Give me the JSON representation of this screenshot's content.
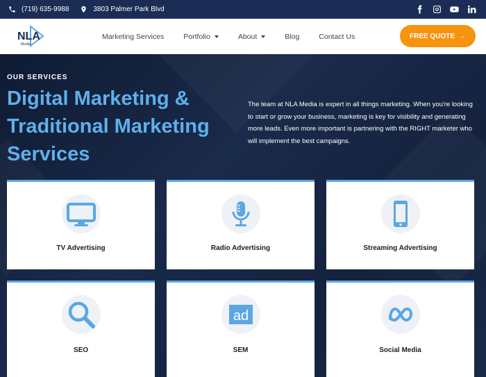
{
  "topbar": {
    "phone": "(719) 635-9988",
    "address": "3803 Palmer Park Blvd",
    "social_icons": [
      "facebook-icon",
      "instagram-icon",
      "youtube-icon",
      "linkedin-icon"
    ]
  },
  "header": {
    "logo_text": "NLA",
    "logo_subtext": "Media",
    "nav": [
      {
        "label": "Marketing Services",
        "dropdown": false
      },
      {
        "label": "Portfolio",
        "dropdown": true
      },
      {
        "label": "About",
        "dropdown": true
      },
      {
        "label": "Blog",
        "dropdown": false
      },
      {
        "label": "Contact Us",
        "dropdown": false
      }
    ],
    "cta_label": "FREE QUOTE",
    "cta_arrow": "→"
  },
  "hero": {
    "eyebrow": "OUR SERVICES",
    "title_line1": "Digital Marketing &",
    "title_line2": "Traditional Marketing",
    "title_line3": "Services",
    "text": "The team at NLA Media is expert in all things marketing.  When you're looking to start or grow your business, marketing is key for visibility and generating more leads.  Even more important is partnering with the RIGHT marketer who will implement the best campaigns."
  },
  "services": [
    {
      "label": "TV Advertising",
      "icon": "tv-icon"
    },
    {
      "label": "Radio Advertising",
      "icon": "microphone-icon"
    },
    {
      "label": "Streaming Advertising",
      "icon": "mobile-phone-icon"
    },
    {
      "label": "SEO",
      "icon": "magnifier-icon"
    },
    {
      "label": "SEM",
      "icon": "ad-icon"
    },
    {
      "label": "Social Media",
      "icon": "meta-icon"
    }
  ],
  "colors": {
    "topbar_bg": "#1b2d55",
    "hero_bg": "#162544",
    "accent_blue": "#5fb0ea",
    "cta_orange": "#f7940d",
    "icon_blue": "#5aa7e4"
  }
}
